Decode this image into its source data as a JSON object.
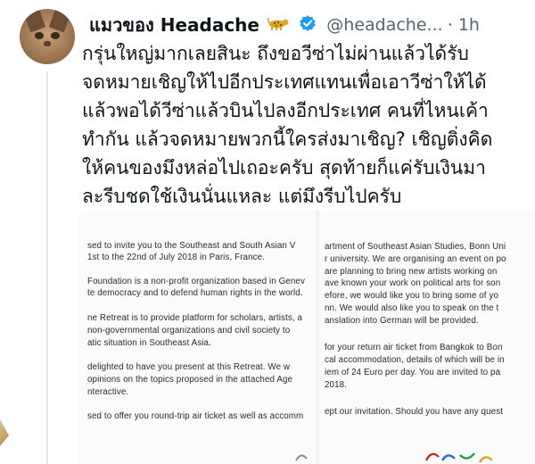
{
  "tweet": {
    "author": {
      "display_name": "แมวของ Headache",
      "emoji": "leopard-emoji",
      "verified": true,
      "handle": "@headache...",
      "time": "· 1h"
    },
    "text_lines": [
      "กรุ่นใหญ่มากเลยสินะ ถึงขอวีซ่าไม่ผ่านแล้วได้รับ",
      "จดหมายเชิญให้ไปอีกประเทศแทนเพื่อเอาวีซ่าให้ได้",
      "แล้วพอได้วีซ่าแล้วบินไปลงอีกประเทศ คนที่ไหนเค้า",
      "ทำกัน แล้วจดหมายพวกนี้ใครส่งมาเชิญ? เชิญติ่งคิด",
      "ให้คนของมึงหล่อไปเถอะครับ สุดท้ายก็แค่รับเงินมา",
      "ละรีบชดใช้เงินนั่นแหละ แต่มึงรีบไปครับ"
    ]
  },
  "media": {
    "left_document_lines": [
      "sed to invite you to the Southeast and South Asian V",
      "1st to the 22nd of July 2018 in Paris, France.",
      "Foundation is a non-profit organization based in Genev",
      "te democracy and to defend human rights in the world.",
      "ne Retreat is to provide platform for scholars, artists, a",
      "non-governmental organizations and civil society to",
      "atic situation in Southeast Asia.",
      "delighted to have you present at this Retreat. We w",
      "opinions on the topics proposed in the attached Age",
      "nteractive.",
      "sed to offer you round-trip air ticket as well as accomm"
    ],
    "right_document_lines": [
      "artment of Southeast Asian Studies, Bonn Uni",
      "r university. We are organising an event on po",
      "are planning to bring new artists working on",
      "ave known your work on political arts for son",
      "efore, we would like you to bring some of yo",
      "nn. We would also like you to speak on the t",
      "anslation into German will be provided.",
      "for your return air ticket from Bangkok to Bon",
      "cal accommodation, details of which will be in",
      "iem of 24 Euro per day. You are invited to pa",
      "2018.",
      "ept our invitation. Should you have any quest"
    ]
  },
  "colors": {
    "text_primary": "#0f1419",
    "text_secondary": "#536471",
    "verified_blue": "#1d9bf0"
  }
}
